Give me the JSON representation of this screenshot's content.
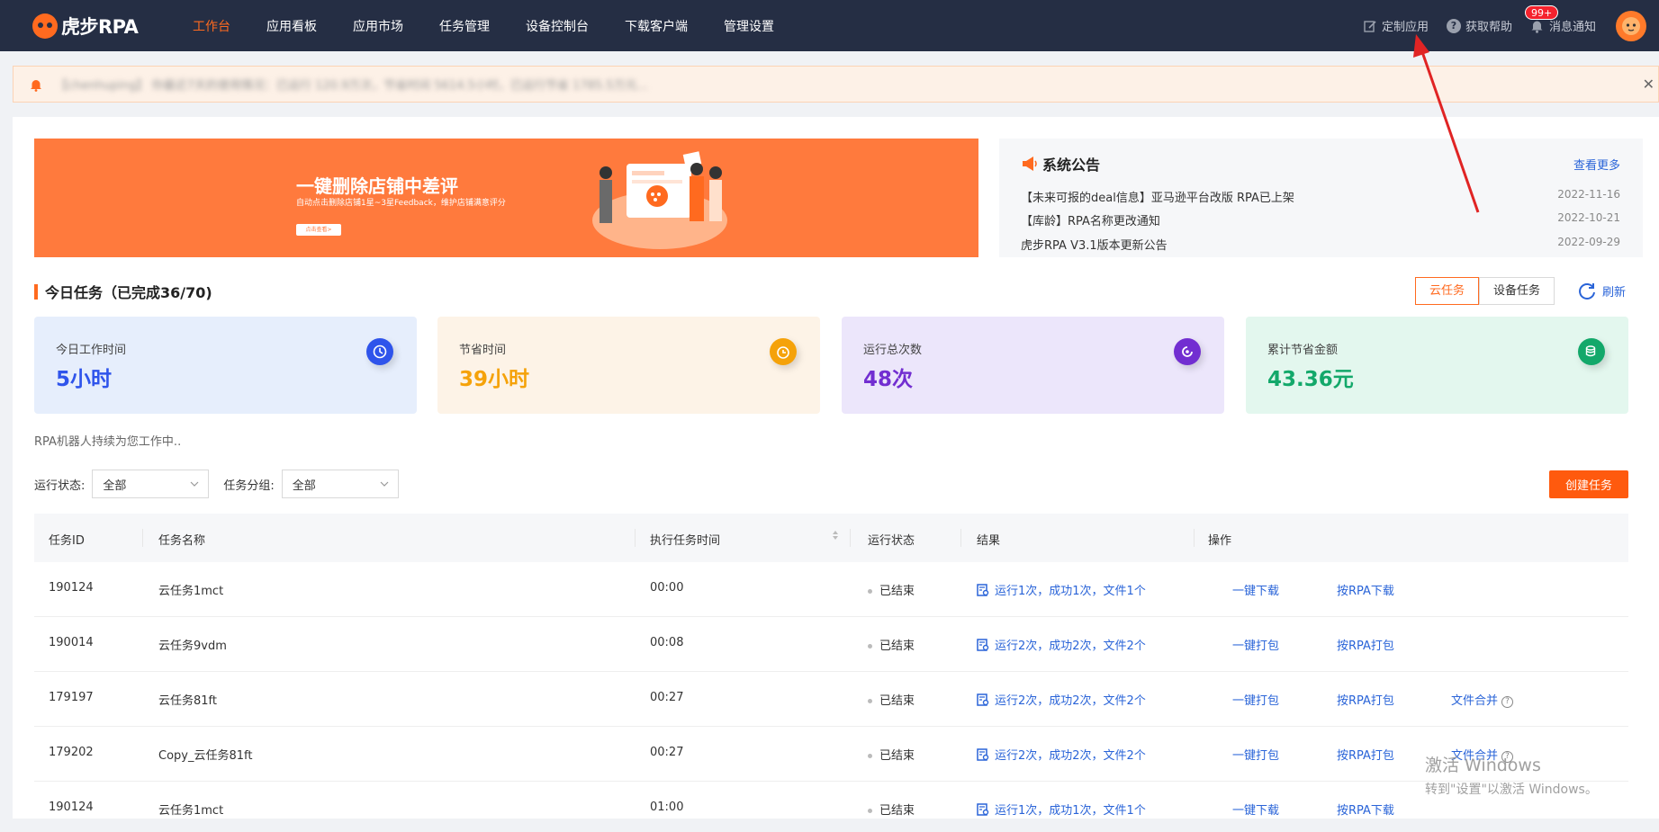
{
  "topbar": {
    "logo_text": "虎步RPA",
    "nav": [
      "工作台",
      "应用看板",
      "应用市场",
      "任务管理",
      "设备控制台",
      "下载客户端",
      "管理设置"
    ],
    "active_nav": 0,
    "custom_app": "定制应用",
    "get_help": "获取帮助",
    "messages": "消息通知",
    "message_badge": "99+"
  },
  "notice_bar": {
    "text": "【chenhuping】 你最近7天的使用情况：已运行 120.9万次，节省时间 5614.5小时，已运行节省 1785.5万元..."
  },
  "banner": {
    "title": "一键删除店铺中差评",
    "subtitle": "自动点击删除店铺1星~3星Feedback，维护店铺满意评分",
    "button": "点击查看>"
  },
  "announcements": {
    "title": "系统公告",
    "more": "查看更多",
    "items": [
      {
        "text": "【未来可报的deal信息】亚马逊平台改版 RPA已上架",
        "date": "2022-11-16"
      },
      {
        "text": "【库龄】RPA名称更改通知",
        "date": "2022-10-21"
      },
      {
        "text": "虎步RPA V3.1版本更新公告",
        "date": "2022-09-29"
      }
    ]
  },
  "today_tasks": {
    "title": "今日任务（已完成36/70)",
    "tabs": [
      "云任务",
      "设备任务"
    ],
    "active_tab": 0,
    "refresh": "刷新"
  },
  "stats": [
    {
      "label": "今日工作时间",
      "value": "5小时",
      "color": "#2f54eb",
      "bg": "#e6eefc",
      "icon": "clock-icon"
    },
    {
      "label": "节省时间",
      "value": "39小时",
      "color": "#f5a20a",
      "bg": "#fdf3e7",
      "icon": "timer-icon"
    },
    {
      "label": "运行总次数",
      "value": "48次",
      "color": "#722ed1",
      "bg": "#ece6fb",
      "icon": "refresh-icon"
    },
    {
      "label": "累计节省金额",
      "value": "43.36元",
      "color": "#13a86a",
      "bg": "#e3f7ee",
      "icon": "coins-icon"
    }
  ],
  "robot_status": "RPA机器人持续为您工作中..",
  "filters": {
    "run_status_label": "运行状态:",
    "run_status_value": "全部",
    "group_label": "任务分组:",
    "group_value": "全部"
  },
  "create_button": "创建任务",
  "table": {
    "headers": [
      "任务ID",
      "任务名称",
      "执行任务时间",
      "运行状态",
      "结果",
      "操作"
    ],
    "rows": [
      {
        "id": "190124",
        "name": "云任务1mct",
        "time": "00:00",
        "status": "已结束",
        "result": "运行1次，成功1次，文件1个",
        "op1": "一键下载",
        "op2": "按RPA下载",
        "op3": ""
      },
      {
        "id": "190014",
        "name": "云任务9vdm",
        "time": "00:08",
        "status": "已结束",
        "result": "运行2次，成功2次，文件2个",
        "op1": "一键打包",
        "op2": "按RPA打包",
        "op3": ""
      },
      {
        "id": "179197",
        "name": "云任务81ft",
        "time": "00:27",
        "status": "已结束",
        "result": "运行2次，成功2次，文件2个",
        "op1": "一键打包",
        "op2": "按RPA打包",
        "op3": "文件合并"
      },
      {
        "id": "179202",
        "name": "Copy_云任务81ft",
        "time": "00:27",
        "status": "已结束",
        "result": "运行2次，成功2次，文件2个",
        "op1": "一键打包",
        "op2": "按RPA打包",
        "op3": "文件合并"
      },
      {
        "id": "190124",
        "name": "云任务1mct",
        "time": "01:00",
        "status": "已结束",
        "result": "运行1次，成功1次，文件1个",
        "op1": "一键下载",
        "op2": "按RPA下载",
        "op3": ""
      }
    ]
  },
  "watermark": {
    "line1": "激活 Windows",
    "line2": "转到\"设置\"以激活 Windows。"
  },
  "colors": {
    "accent": "#ff6a1f",
    "nav_bg": "#252e44",
    "link": "#2a64d8"
  }
}
